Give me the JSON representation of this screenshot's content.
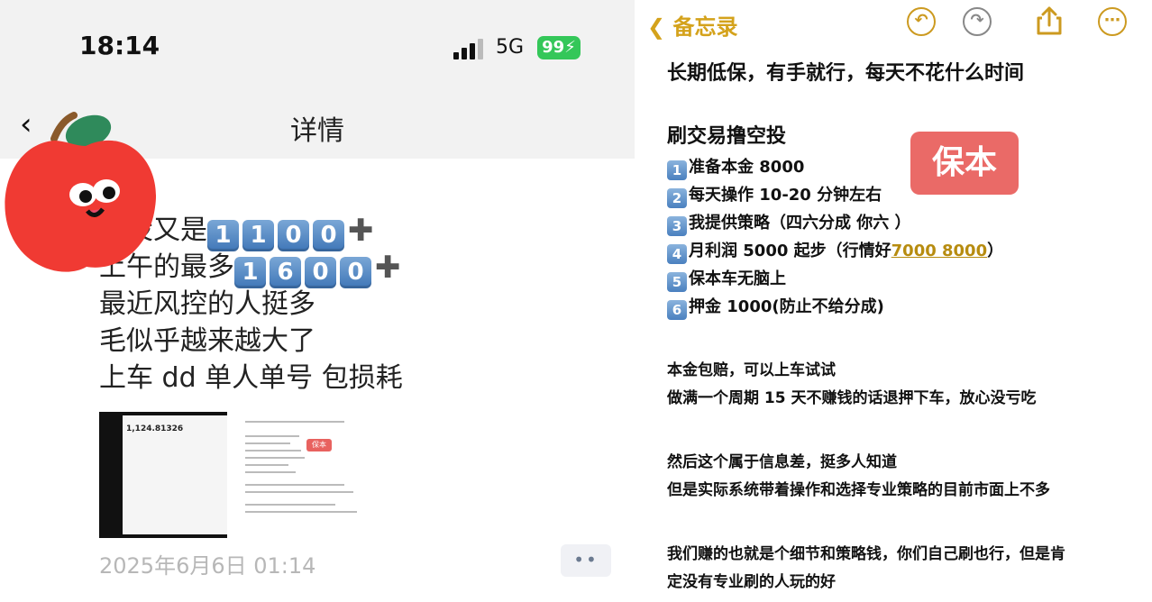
{
  "left": {
    "status_bar": {
      "time": "18:14",
      "network": "5G",
      "battery": "99"
    },
    "nav": {
      "title": "详情"
    },
    "message": {
      "lines": [
        {
          "text": "空投又是",
          "keycaps": [
            "1",
            "1",
            "0",
            "0"
          ],
          "plus": "✚"
        },
        {
          "text": "上午的最多",
          "keycaps": [
            "1",
            "6",
            "0",
            "0"
          ],
          "plus": "✚"
        },
        {
          "text": "最近风控的人挺多"
        },
        {
          "text": "毛似乎越来越大了"
        },
        {
          "text": "上车 dd 单人单号 包损耗"
        }
      ]
    },
    "thumbnail": {
      "balance": "1,124.81326",
      "badge": "保本"
    },
    "timestamp": "2025年6月6日 01:14",
    "more_label": "••"
  },
  "right": {
    "toolbar": {
      "back_label": "备忘录",
      "undo_icon": "undo-icon",
      "redo_icon": "redo-icon",
      "share_icon": "share-icon",
      "more_icon": "more-icon",
      "accent_color": "#cc9a20"
    },
    "note": {
      "headline": "长期低保，有手就行，每天不花什么时间",
      "section_title": "刷交易撸空投",
      "badge": "保本",
      "steps": [
        {
          "num": "1",
          "text": "准备本金 8000"
        },
        {
          "num": "2",
          "text": "每天操作 10-20 分钟左右"
        },
        {
          "num": "3",
          "text": "我提供策略（四六分成 你六 ）"
        },
        {
          "num": "4",
          "text": "月利润 5000 起步（行情好",
          "highlight": "7000 8000",
          "suffix": "）"
        },
        {
          "num": "5",
          "text": "保本车无脑上"
        },
        {
          "num": "6",
          "text": "押金 1000(防止不给分成)"
        }
      ],
      "paragraphs": [
        [
          "本金包赔，可以上车试试",
          "做满一个周期 15 天不赚钱的话退押下车，放心没亏吃"
        ],
        [
          "然后这个属于信息差，挺多人知道",
          "但是实际系统带着操作和选择专业策略的目前市面上不多"
        ],
        [
          "我们赚的也就是个细节和策略钱，你们自己刷也行，但是肯",
          "定没有专业刷的人玩的好"
        ]
      ]
    }
  }
}
